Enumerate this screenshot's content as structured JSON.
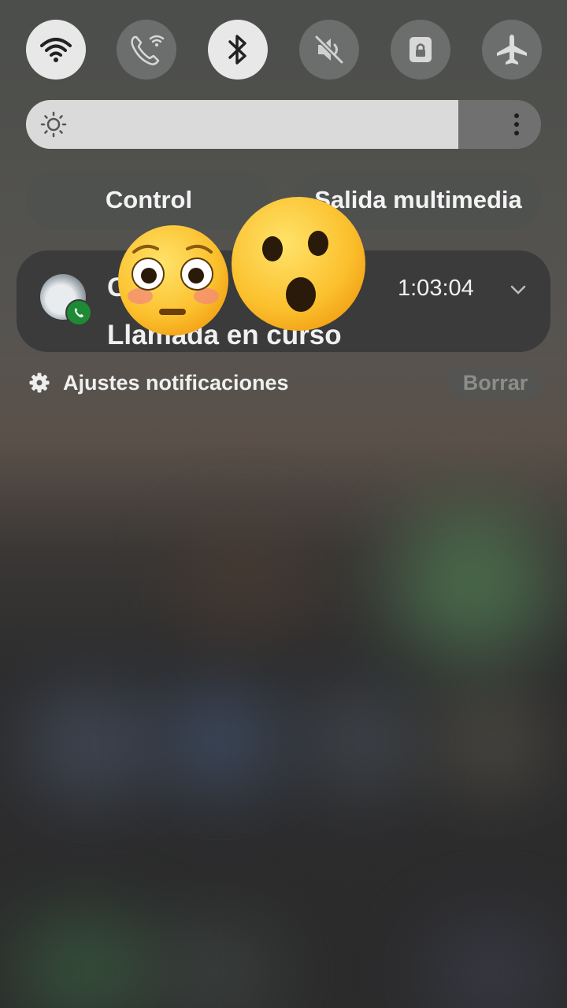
{
  "quick_settings": [
    {
      "name": "wifi-toggle",
      "icon": "wifi-icon",
      "state": "on"
    },
    {
      "name": "wifi-calling-toggle",
      "icon": "wifi-calling-icon",
      "state": "off"
    },
    {
      "name": "bluetooth-toggle",
      "icon": "bluetooth-icon",
      "state": "on"
    },
    {
      "name": "sound-toggle",
      "icon": "mute-icon",
      "state": "off"
    },
    {
      "name": "rotation-lock-toggle",
      "icon": "lock-icon",
      "state": "off"
    },
    {
      "name": "airplane-mode-toggle",
      "icon": "airplane-icon",
      "state": "off"
    }
  ],
  "brightness": {
    "level": 0.84,
    "icon": "sun-icon",
    "menu_icon": "more-vert-icon"
  },
  "media_buttons": {
    "control": "Control",
    "media_output": "Salida multimedia"
  },
  "notification": {
    "caller_visible": "C          a                a",
    "timer": "1:03:04",
    "status": "Llamada en curso",
    "badge_icon": "phone-icon",
    "expand_icon": "chevron-down-icon"
  },
  "footer": {
    "settings_label": "Ajustes notificaciones",
    "clear_label": "Borrar"
  },
  "stickers": [
    "flushed-face-emoji",
    "astonished-face-emoji"
  ],
  "colors": {
    "tile_on": "#e8e8e8",
    "tile_off": "#6c6e6d",
    "call_badge": "#1e8a35"
  }
}
